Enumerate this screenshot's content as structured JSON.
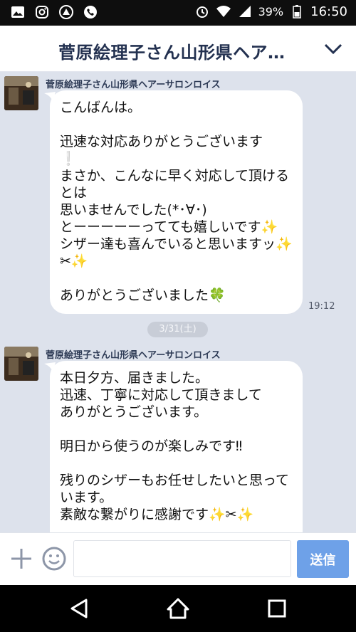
{
  "status_bar": {
    "battery_percent": "39%",
    "time": "16:50",
    "left_icons": [
      "gallery-icon",
      "instagram-icon",
      "cloud-app-icon",
      "phone-icon"
    ],
    "right_icons": [
      "alarm-icon",
      "wifi-icon",
      "signal-icon",
      "battery-icon"
    ]
  },
  "header": {
    "title": "菅原絵理子さん山形県ヘア…",
    "chevron_icon": "chevron-down-icon"
  },
  "messages": [
    {
      "sender": "菅原絵理子さん山形県ヘアーサロンロイス",
      "text": "こんばんは。\n\n迅速な対応ありがとうございます\n❕\nまさか、こんなに早く対応して頂けるとは\n思いませんでした(*･∀･)\nとーーーーーってても嬉しいです✨\nシザー達も喜んでいると思いますッ✨✂✨\n\nありがとうございました🍀",
      "time": "19:12"
    },
    {
      "sender": "菅原絵理子さん山形県ヘアーサロンロイス",
      "text": "本日夕方、届きました。\n迅速、丁寧に対応して頂きまして\nありがとうございます。\n\n明日から使うのが楽しみです‼\n\n残りのシザーもお任せしたいと思っています。\n素敵な繋がりに感謝です✨✂✨",
      "time": ""
    }
  ],
  "date_separator": "3/31(土)",
  "input_bar": {
    "placeholder": "",
    "send_label": "送信"
  },
  "colors": {
    "header_title": "#233150",
    "chat_background": "#dde2ec",
    "send_button": "#6ea1e8"
  }
}
